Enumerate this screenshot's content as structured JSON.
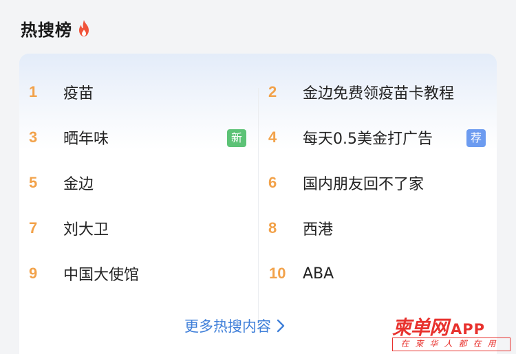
{
  "header": {
    "title": "热搜榜",
    "icon": "fire-icon",
    "icon_color": "#f0533a"
  },
  "hot_list": [
    {
      "rank": "1",
      "label": "疫苗",
      "tag": ""
    },
    {
      "rank": "2",
      "label": "金边免费领疫苗卡教程",
      "tag": ""
    },
    {
      "rank": "3",
      "label": "晒年味",
      "tag": "新",
      "tag_color": "#5cc276"
    },
    {
      "rank": "4",
      "label": "每天0.5美金打广告",
      "tag": "荐",
      "tag_color": "#6c9bf0"
    },
    {
      "rank": "5",
      "label": "金边",
      "tag": ""
    },
    {
      "rank": "6",
      "label": "国内朋友回不了家",
      "tag": ""
    },
    {
      "rank": "7",
      "label": "刘大卫",
      "tag": ""
    },
    {
      "rank": "8",
      "label": "西港",
      "tag": ""
    },
    {
      "rank": "9",
      "label": "中国大使馆",
      "tag": ""
    },
    {
      "rank": "10",
      "label": "ABA",
      "tag": ""
    }
  ],
  "footer": {
    "more_label": "更多热搜内容",
    "more_icon": "chevron-right-icon"
  },
  "watermark": {
    "logo_text": "柬单网",
    "app_text": "APP",
    "slogan": "在柬华人都在用",
    "color": "#e8322e"
  },
  "colors": {
    "rank": "#f2a24a",
    "link": "#3f7fd9"
  }
}
